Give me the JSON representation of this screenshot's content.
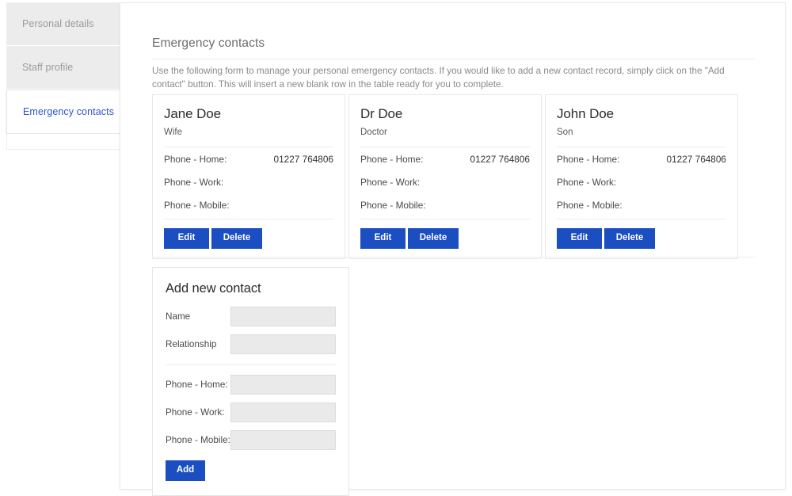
{
  "sidebar": {
    "items": [
      {
        "label": "Personal details",
        "active": false
      },
      {
        "label": "Staff profile",
        "active": false
      },
      {
        "label": "Emergency contacts",
        "active": true
      }
    ]
  },
  "main": {
    "title": "Emergency contacts",
    "intro": "Use the following form to manage your personal emergency contacts. If you would like to add a new contact record, simply click on the \"Add contact\" button. This will insert a new blank row in the table ready for you to complete.",
    "contacts": [
      {
        "name": "Jane Doe",
        "relationship": "Wife",
        "phones": [
          {
            "label": "Phone - Home:",
            "value": "01227 764806"
          },
          {
            "label": "Phone - Work:",
            "value": ""
          },
          {
            "label": "Phone - Mobile:",
            "value": ""
          }
        ],
        "edit_label": "Edit",
        "delete_label": "Delete"
      },
      {
        "name": "Dr Doe",
        "relationship": "Doctor",
        "phones": [
          {
            "label": "Phone - Home:",
            "value": "01227 764806"
          },
          {
            "label": "Phone - Work:",
            "value": ""
          },
          {
            "label": "Phone - Mobile:",
            "value": ""
          }
        ],
        "edit_label": "Edit",
        "delete_label": "Delete"
      },
      {
        "name": "John Doe",
        "relationship": "Son",
        "phones": [
          {
            "label": "Phone - Home:",
            "value": "01227 764806"
          },
          {
            "label": "Phone - Work:",
            "value": ""
          },
          {
            "label": "Phone - Mobile:",
            "value": ""
          }
        ],
        "edit_label": "Edit",
        "delete_label": "Delete"
      }
    ],
    "add_form": {
      "title": "Add new contact",
      "fields": [
        {
          "label": "Name",
          "value": "",
          "placeholder": ""
        },
        {
          "label": "Relationship",
          "value": "",
          "placeholder": ""
        }
      ],
      "phone_fields": [
        {
          "label": "Phone - Home:",
          "value": "",
          "placeholder": ""
        },
        {
          "label": "Phone - Work:",
          "value": "",
          "placeholder": ""
        },
        {
          "label": "Phone - Mobile:",
          "value": "",
          "placeholder": ""
        }
      ],
      "submit_label": "Add"
    }
  },
  "colors": {
    "accent": "#1b4ec1",
    "active_tab_text": "#2f55d4",
    "sidebar_inactive_bg": "#ececec",
    "input_bg": "#eaeaea"
  }
}
